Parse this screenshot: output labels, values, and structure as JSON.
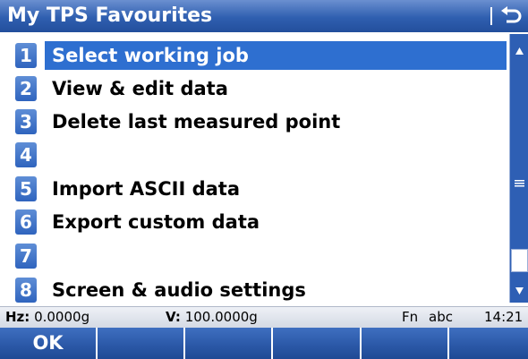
{
  "window": {
    "title": "My TPS Favourites"
  },
  "menu": {
    "items": [
      {
        "number": "1",
        "label": "Select working job",
        "selected": true
      },
      {
        "number": "2",
        "label": "View & edit data",
        "selected": false
      },
      {
        "number": "3",
        "label": "Delete last measured point",
        "selected": false
      },
      {
        "number": "4",
        "label": "",
        "selected": false
      },
      {
        "number": "5",
        "label": "Import ASCII data",
        "selected": false
      },
      {
        "number": "6",
        "label": "Export custom data",
        "selected": false
      },
      {
        "number": "7",
        "label": "",
        "selected": false
      },
      {
        "number": "8",
        "label": "Screen & audio settings",
        "selected": false
      }
    ]
  },
  "status": {
    "hz_label": "Hz:",
    "hz_value": "0.0000g",
    "v_label": "V:",
    "v_value": "100.0000g",
    "fn": "Fn",
    "input_mode": "abc",
    "time": "14:21"
  },
  "softkeys": [
    "OK",
    "",
    "",
    "",
    "",
    ""
  ],
  "colors": {
    "title_bar": "#2f5fb0",
    "selection": "#2e6fd0",
    "number_badge": "#3d6fc6",
    "softkey_bar": "#2a57a6"
  }
}
